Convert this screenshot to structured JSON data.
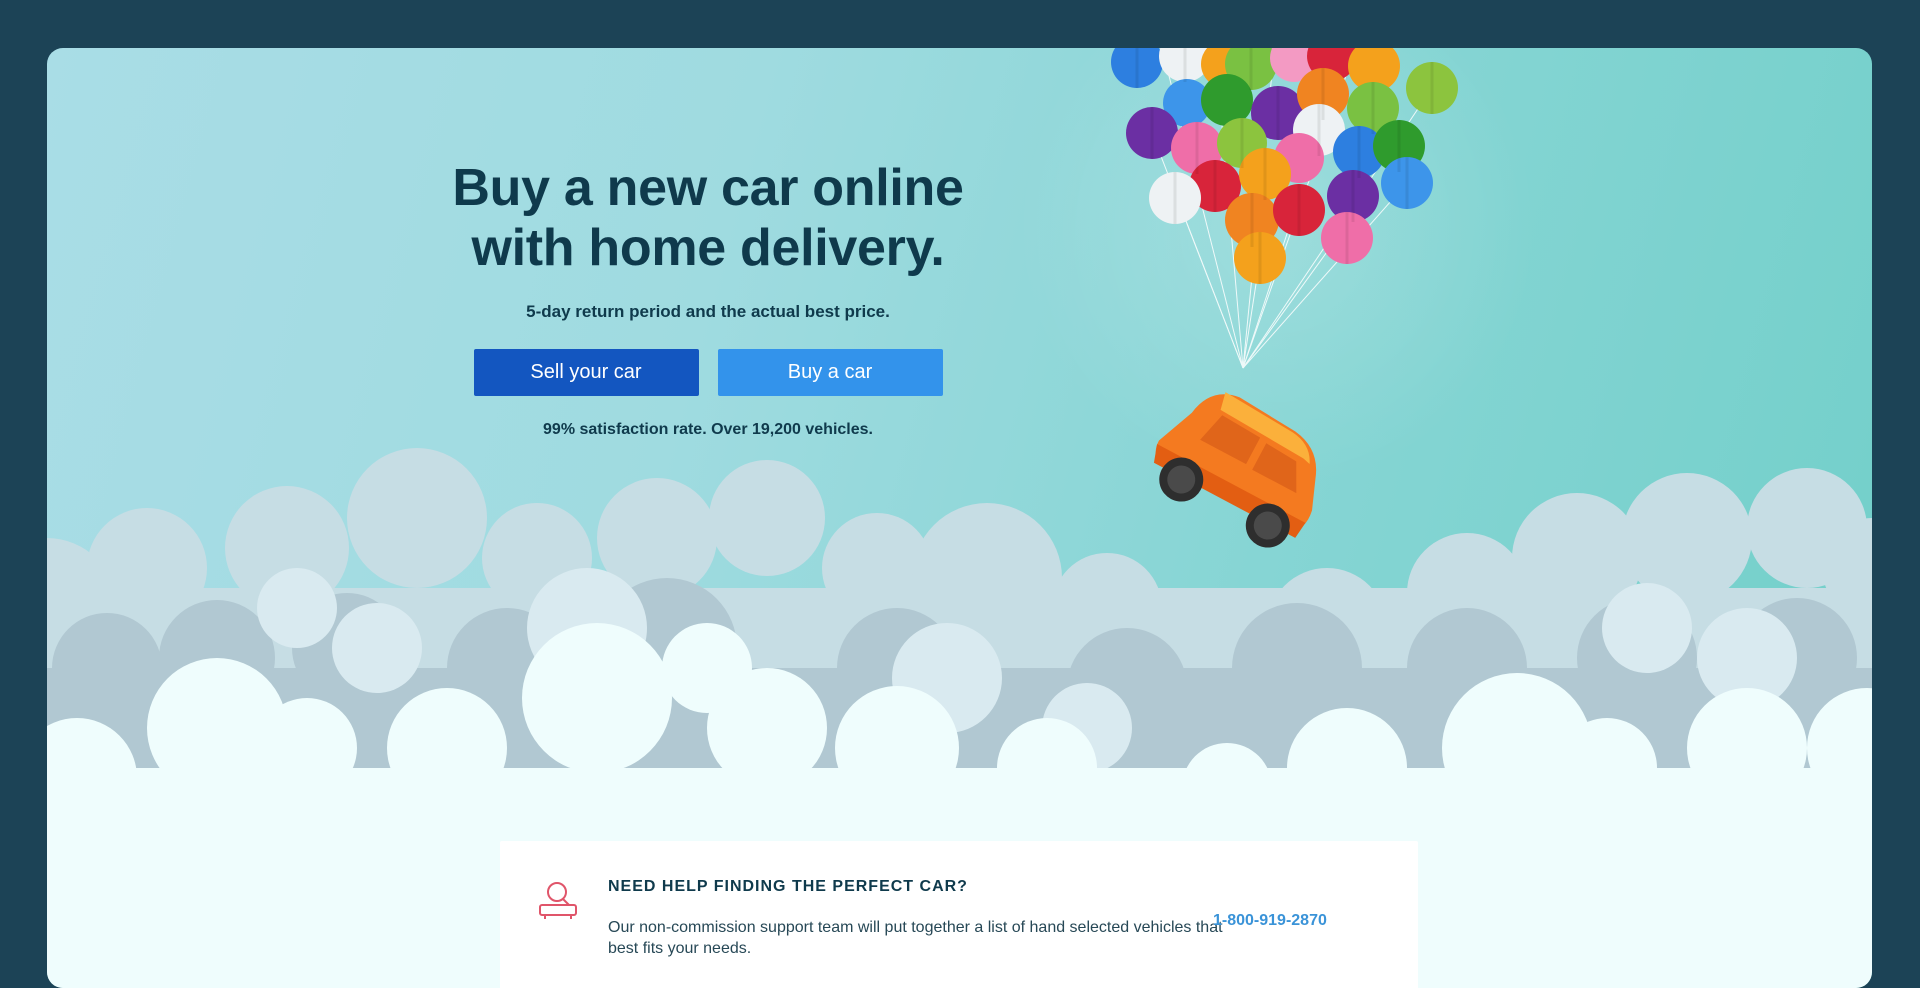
{
  "hero": {
    "headline": "Buy a new car online with home delivery.",
    "subline": "5-day return period and the actual best price.",
    "sell_button_label": "Sell your car",
    "buy_button_label": "Buy a car",
    "stat_line": "99% satisfaction rate. Over 19,200 vehicles."
  },
  "help": {
    "title": "Need help finding the perfect car?",
    "body": "Our non-commission support team will put together a list of hand selected vehicles that best fits your needs.",
    "phone": "1-800-919-2870"
  },
  "colors": {
    "page_background": "#1c4356",
    "primary_button": "#1356c0",
    "secondary_button": "#3393eb",
    "heading_text": "#0f3a4c",
    "phone_link": "#3a93d8",
    "help_icon": "#e0556a",
    "car": "#f47a20"
  },
  "icons": {
    "help_icon": "search-car-icon"
  }
}
